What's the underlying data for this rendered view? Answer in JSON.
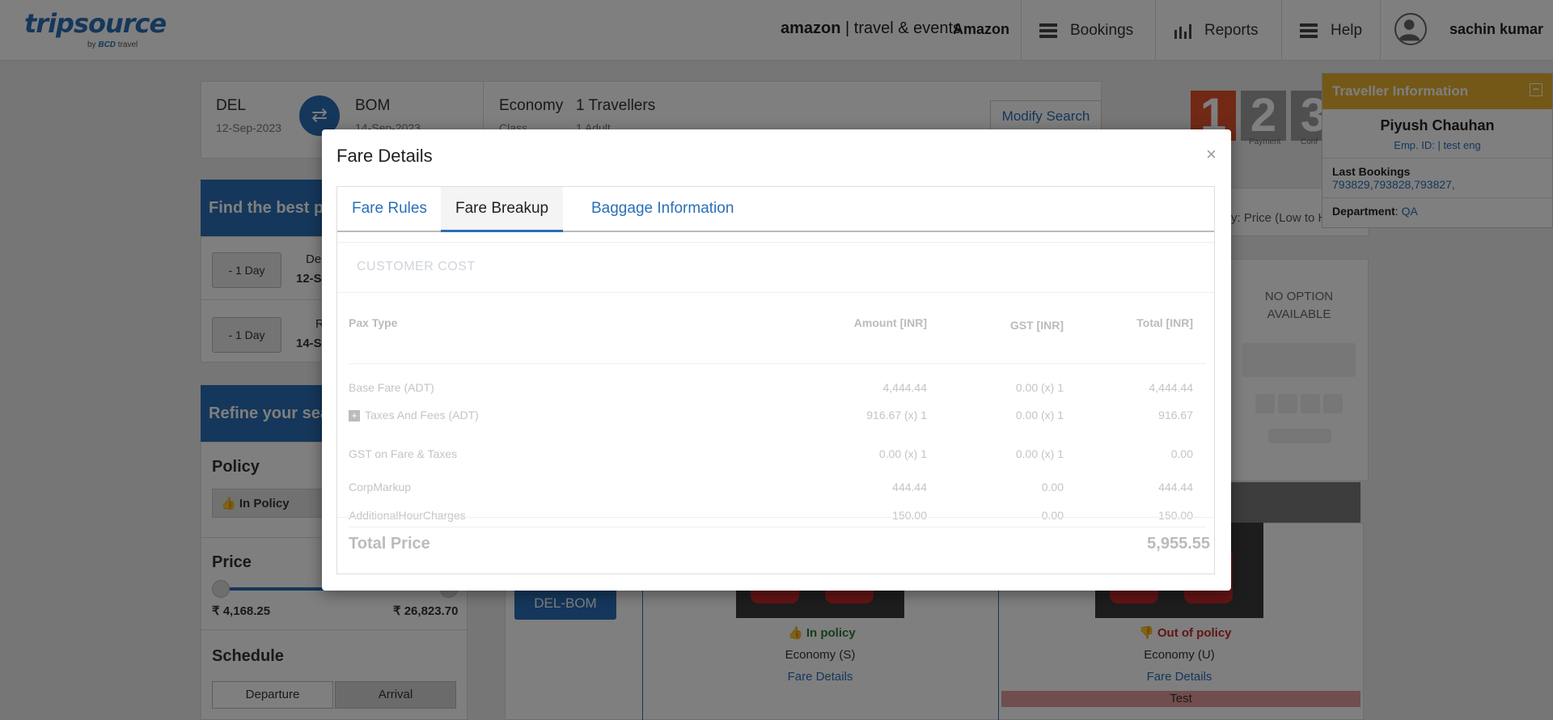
{
  "header": {
    "logo_main": "tripsource",
    "logo_sub_by": "by",
    "logo_sub_brand": "BCD",
    "logo_sub_travel": "travel",
    "partner_logo": "amazon",
    "partner_text": "travel & events",
    "company": "Amazon",
    "nav": {
      "bookings": "Bookings",
      "reports": "Reports",
      "help": "Help"
    },
    "user": "sachin kumar"
  },
  "search": {
    "from_city": "DEL",
    "from_date": "12-Sep-2023",
    "to_city": "BOM",
    "to_date": "14-Sep-2023",
    "class_value": "Economy",
    "class_label": "Class",
    "travellers_value": "1 Travellers",
    "travellers_label": "1 Adult",
    "modify_label": "Modify Search"
  },
  "steps": {
    "s1": "1",
    "s2": "2",
    "s3": "3",
    "s2_label": "Payment",
    "s3_label": "Conf"
  },
  "left": {
    "find_best": "Find the best pr",
    "minus_day": "- 1 Day",
    "dep_label": "De",
    "dep_date": "12-S",
    "ret_label": "R",
    "ret_date": "14-S",
    "refine": "Refine your sea",
    "policy_title": "Policy",
    "in_policy": "In Policy",
    "price_title": "Price",
    "price_min": "₹ 4,168.25",
    "price_max": "₹ 26,823.70",
    "schedule_title": "Schedule",
    "departure": "Departure",
    "arrival": "Arrival"
  },
  "right": {
    "sort_text": "y: Price (Low to H",
    "no_option": "NO OPTION AVAILABLE"
  },
  "results": {
    "route": "DEL-BOM",
    "card1": {
      "policy": "In policy",
      "cabin": "Economy (S)",
      "link": "Fare Details"
    },
    "card2": {
      "policy": "Out of policy",
      "cabin": "Economy (U)",
      "link": "Fare Details",
      "tag": "Test"
    }
  },
  "traveller": {
    "title": "Traveller Information",
    "collapse": "−",
    "name": "Piyush Chauhan",
    "emp": "Emp. ID: | test eng",
    "last_bookings_label": "Last Bookings",
    "last_bookings": "793829,793828,793827,",
    "department_label": "Department",
    "department_value": "QA"
  },
  "modal": {
    "title": "Fare Details",
    "close": "×",
    "tabs": [
      "Fare Rules",
      "Fare Breakup",
      "Baggage Information"
    ],
    "active_tab": "Fare Breakup",
    "section": "CUSTOMER COST",
    "columns": {
      "pax": "Pax Type",
      "amount": "Amount [INR]",
      "gst": "GST [INR]",
      "total": "Total [INR]"
    },
    "rows": [
      {
        "label": "Base Fare (ADT)",
        "amount": "4,444.44",
        "gst": "0.00 (x) 1",
        "total": "4,444.44"
      },
      {
        "label": "Taxes And Fees (ADT)",
        "amount": "916.67 (x) 1",
        "gst": "0.00 (x) 1",
        "total": "916.67"
      },
      {
        "label": "GST on Fare & Taxes",
        "amount": "0.00 (x) 1",
        "gst": "0.00 (x) 1",
        "total": "0.00"
      },
      {
        "label": "CorpMarkup",
        "amount": "444.44",
        "gst": "0.00",
        "total": "444.44"
      },
      {
        "label": "AdditionalHourCharges",
        "amount": "150.00",
        "gst": "0.00",
        "total": "150.00"
      }
    ],
    "total_label": "Total Price",
    "total_value": "5,955.55"
  },
  "colors": {
    "brand": "#2a6fb6",
    "accent": "#e6b030",
    "in_policy": "#2e7d32",
    "out_policy": "#c62828"
  }
}
